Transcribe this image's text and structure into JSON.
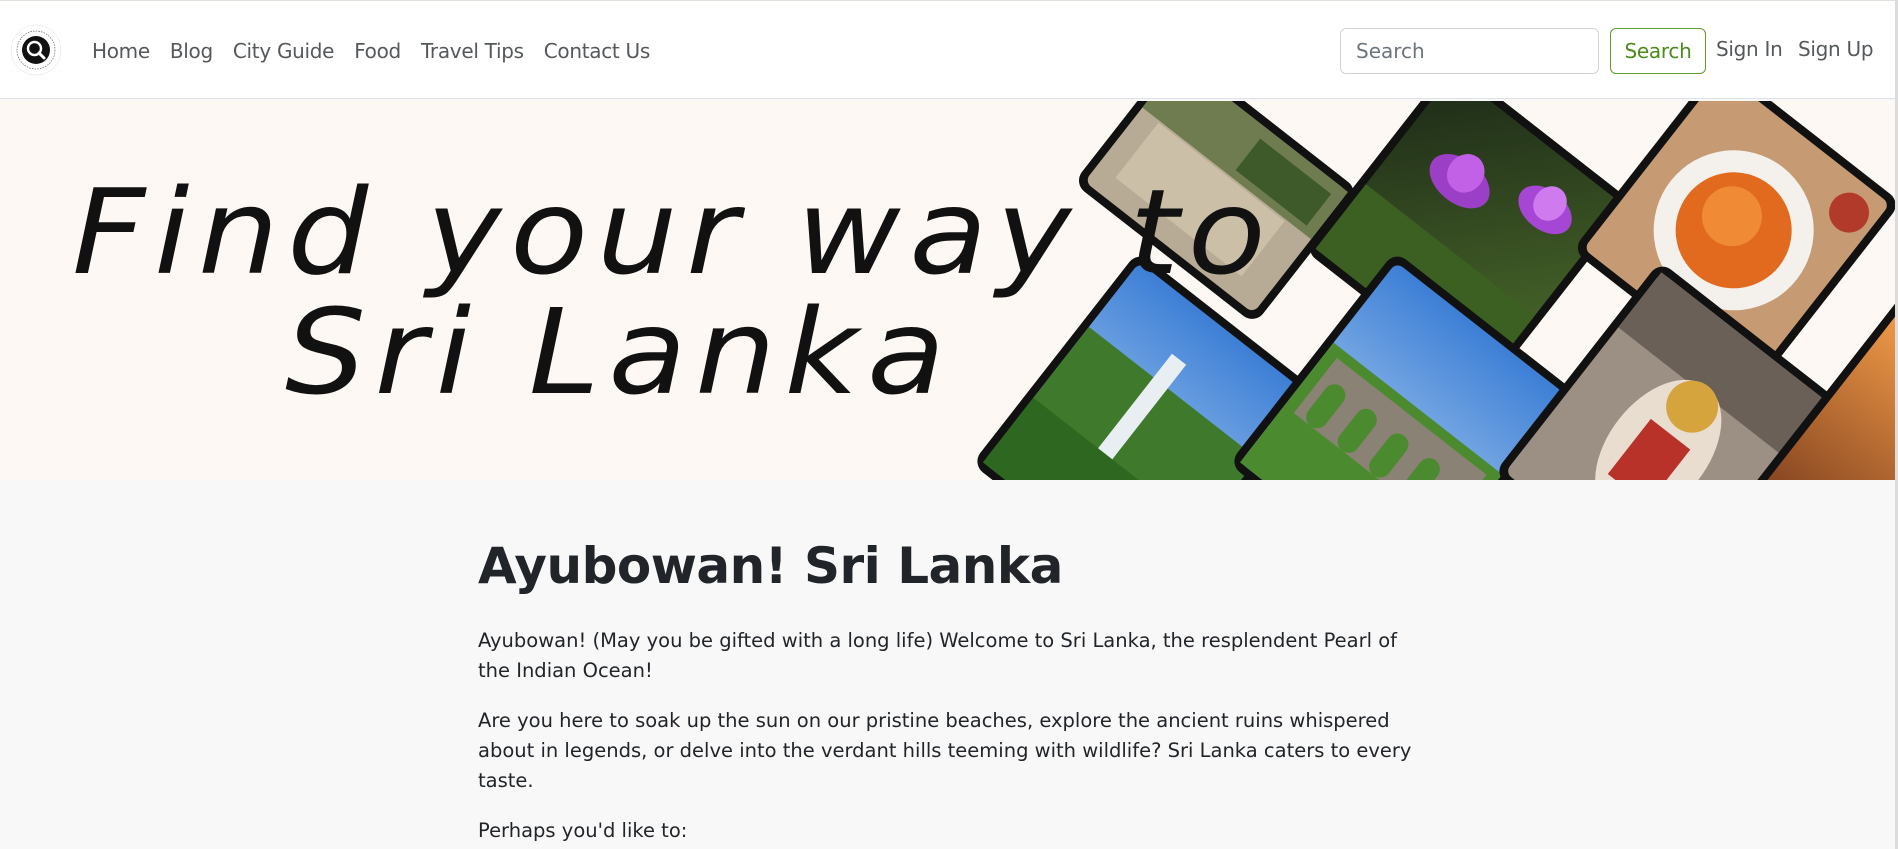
{
  "navbar": {
    "logo_text": "Find your way to Sri Lanka",
    "links": [
      "Home",
      "Blog",
      "City Guide",
      "Food",
      "Travel Tips",
      "Contact Us"
    ],
    "search_placeholder": "Search",
    "search_button": "Search",
    "sign_in": "Sign In",
    "sign_up": "Sign Up"
  },
  "hero": {
    "line1": "Find your way to",
    "line2": "Sri Lanka",
    "photos": [
      "ruins-photo",
      "lotus-photo",
      "sambol-photo",
      "waterfall-photo",
      "nine-arch-bridge-photo",
      "kandyan-dancer-photo",
      "sunset-photo"
    ]
  },
  "main": {
    "title": "Ayubowan! Sri Lanka",
    "paragraphs": [
      "Ayubowan! (May you be gifted with a long life) Welcome to Sri Lanka, the resplendent Pearl of the Indian Ocean!",
      "Are you here to soak up the sun on our pristine beaches, explore the ancient ruins whispered about in legends, or delve into the verdant hills teeming with wildlife? Sri Lanka caters to every taste.",
      "Perhaps you'd like to:"
    ]
  },
  "colors": {
    "accent_green": "#4c8a1c",
    "hero_bg": "#fdf8f3",
    "page_bg": "#f8f8f8",
    "nav_text": "#55595c"
  }
}
